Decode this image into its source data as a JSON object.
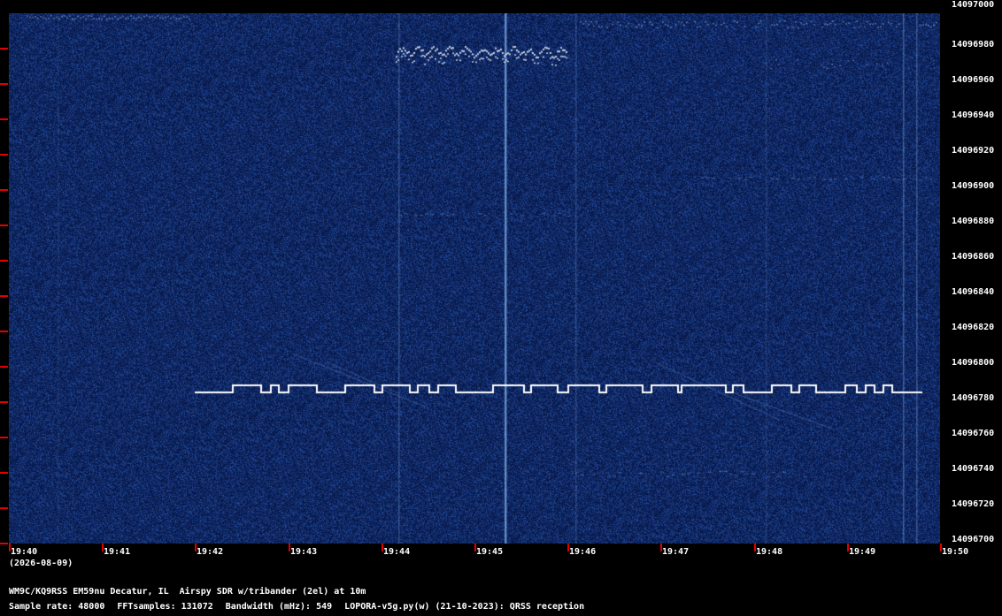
{
  "station_line": "WM9C/KQ9RSS EM59nu Decatur, IL  Airspy SDR w/tribander (2el) at 10m",
  "date_label": "(2026-08-09)",
  "info": {
    "sample_rate": "Sample rate: 48000",
    "fft_samples": "FFTsamples: 131072",
    "bandwidth": "Bandwidth (mHz): 549",
    "software": "LOPORA-v5g.py(w) (21-10-2023): QRSS reception"
  },
  "frequency_labels": [
    "14097000",
    "14096980",
    "14096960",
    "14096940",
    "14096920",
    "14096900",
    "14096880",
    "14096860",
    "14096840",
    "14096820",
    "14096800",
    "14096780",
    "14096760",
    "14096740",
    "14096720",
    "14096700"
  ],
  "time_labels": [
    "19:40",
    "19:41",
    "19:42",
    "19:43",
    "19:44",
    "19:45",
    "19:46",
    "19:47",
    "19:48",
    "19:49",
    "19:50"
  ],
  "colors": {
    "background": "#0a1a55",
    "signal": "#ffffff",
    "tick": "#e00000"
  }
}
